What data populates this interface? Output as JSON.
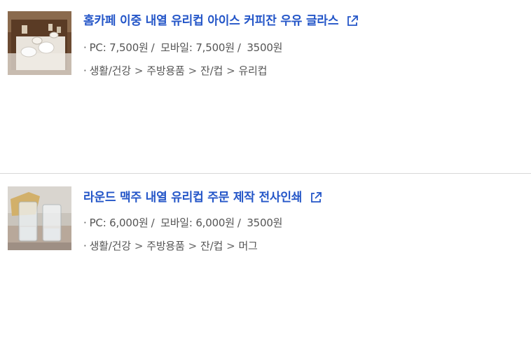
{
  "products": [
    {
      "title": "홈카페 이중 내열 유리컵 아이스 커피잔 우유 글라스",
      "bullet": "·",
      "price_pc": "PC: 7,500원",
      "price_mobile": "모바일: 7,500원",
      "price_extra": "3500원",
      "price_sep": "/",
      "categories": [
        "생활/건강",
        "주방용품",
        "잔/컵",
        "유리컵"
      ],
      "chevron": ">",
      "thumb_icon": "glass-cups-photo"
    },
    {
      "title": "라운드 맥주 내열 유리컵 주문 제작 전사인쇄",
      "bullet": "·",
      "price_pc": "PC: 6,000원",
      "price_mobile": "모바일: 6,000원",
      "price_extra": "3500원",
      "price_sep": "/",
      "categories": [
        "생활/건강",
        "주방용품",
        "잔/컵",
        "머그"
      ],
      "chevron": ">",
      "thumb_icon": "glass-mugs-photo"
    }
  ],
  "colors": {
    "title": "#2456c8",
    "meta": "#555555",
    "divider": "#d8d8d8"
  }
}
